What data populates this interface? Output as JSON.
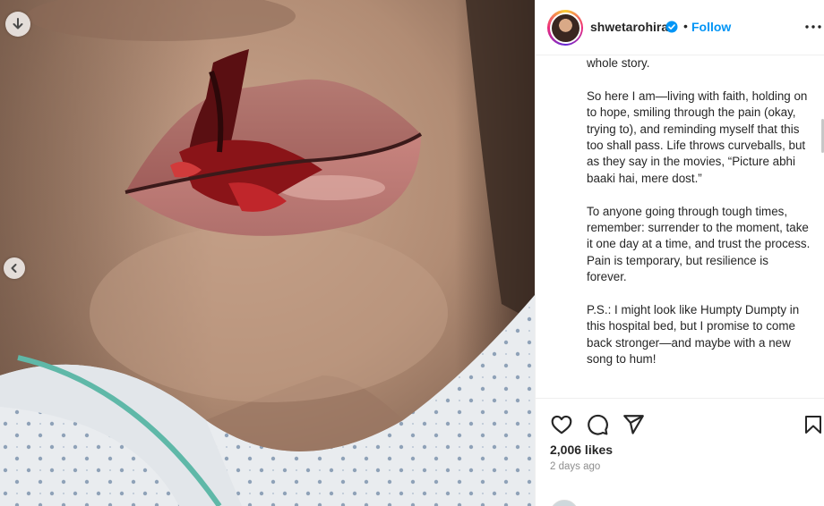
{
  "media": {
    "download_icon": "arrow-down-icon",
    "prev_icon": "chevron-left-icon"
  },
  "header": {
    "username": "shwetarohira",
    "verified_icon": "verified-badge-icon",
    "separator": "•",
    "follow_label": "Follow",
    "more_icon": "more-horizontal-icon"
  },
  "caption": {
    "paragraphs": [
      "whole story.",
      "So here I am—living with faith, holding on to hope, smiling through the pain (okay, trying to), and reminding myself that this too shall pass. Life throws curveballs, but as they say in the movies, “Picture abhi baaki hai, mere dost.”",
      "To anyone going through tough times, remember: surrender to the moment, take it one day at a time, and trust the process. Pain is temporary, but resilience is forever.",
      "P.S.: I might look like Humpty Dumpty in this hospital bed, but I promise to come back stronger—and maybe with a new song to hum!"
    ]
  },
  "actions": {
    "like_icon": "heart-icon",
    "comment_icon": "comment-icon",
    "share_icon": "paper-plane-icon",
    "save_icon": "bookmark-icon",
    "likes": "2,006 likes",
    "time": "2 days ago"
  },
  "colors": {
    "accent": "#0095f6",
    "verified": "#0095f6",
    "text": "#262626",
    "muted": "#8e8e8e"
  }
}
